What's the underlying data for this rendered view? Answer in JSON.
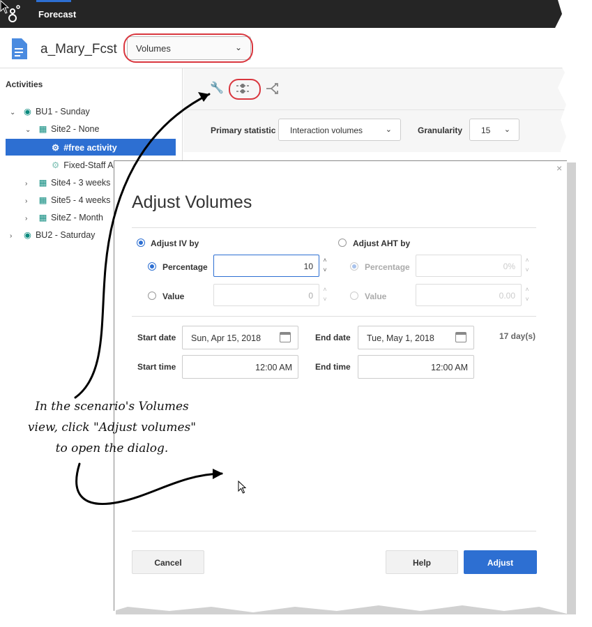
{
  "app": {
    "title": "Forecast",
    "doc_name": "a_Mary_Fcst",
    "view_select": "Volumes"
  },
  "sidebar": {
    "heading": "Activities",
    "items": [
      {
        "label": "BU1 - Sunday"
      },
      {
        "label": "Site2 - None"
      },
      {
        "label": "#free activity"
      },
      {
        "label": "Fixed-Staff A"
      },
      {
        "label": "Site4 - 3 weeks"
      },
      {
        "label": "Site5 - 4 weeks"
      },
      {
        "label": "SiteZ - Month"
      },
      {
        "label": "BU2 - Saturday"
      }
    ]
  },
  "stats": {
    "primary_label": "Primary statistic",
    "primary_value": "Interaction volumes",
    "granularity_label": "Granularity",
    "granularity_value": "15"
  },
  "dialog": {
    "close": "×",
    "title": "Adjust Volumes",
    "adjust_iv_label": "Adjust IV by",
    "adjust_aht_label": "Adjust AHT by",
    "percentage_label": "Percentage",
    "value_label": "Value",
    "iv_percentage": "10",
    "iv_value": "0",
    "aht_percentage": "0%",
    "aht_value": "0.00",
    "start_date_label": "Start date",
    "start_date": "Sun, Apr 15, 2018",
    "end_date_label": "End date",
    "end_date": "Tue, May 1, 2018",
    "days": "17 day(s)",
    "start_time_label": "Start time",
    "start_time": "12:00 AM",
    "end_time_label": "End time",
    "end_time": "12:00 AM",
    "cancel": "Cancel",
    "help": "Help",
    "adjust": "Adjust"
  },
  "annotation": {
    "line1": "In the scenario's Volumes",
    "line2": "view, click \"Adjust volumes\"",
    "line3": "to open the dialog."
  },
  "colors": {
    "accent": "#2d6fd2",
    "highlight": "#d9363e",
    "topbar": "#252525"
  }
}
